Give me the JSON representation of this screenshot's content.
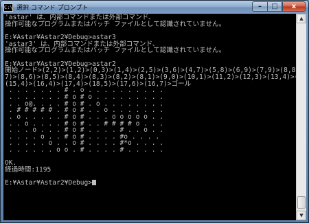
{
  "window": {
    "title": "選択 コマンド プロンプト",
    "app_icon": "cmd-icon",
    "controls": {
      "minimize": "–",
      "maximize": "□",
      "close": "x"
    }
  },
  "console": {
    "text": "'astar' は、内部コマンドまたは外部コマンド、\n操作可能なプログラムまたはバッチ ファイルとして認識されていません。\n\nE:¥Astar¥Astar2¥Debug>astar3\n'astar3' は、内部コマンドまたは外部コマンド、\n操作可能なプログラムまたはバッチ ファイルとして認識されていません。\n\nE:¥Astar¥Astar2¥Debug>astar2\n開始ノード>(2,2)>(1,2)>(0,3)>(1,4)>(2,5)>(3,6)>(4,7)>(5,8)>(6,9)>(7,9)>(8,8)>(8,\n7)>(8,6)>(8,5)>(8,4)>(8,3)>(8,2)>(8,1)>(9,0)>(10,1)>(11,2)>(12,3)>(13,4)>(14,4)>\n(15,4)>(16,4)>(17,4)>(18,5)>(17,6)>(16,7)>ゴール\n . . . . . . . # . o . . . . . . . . . .\n . . . . . . . # o # o . . . . . . . . .\n . . o@. . . . # o # . o . . . . . . . .\n . # # # # # . # o # . . o . . . . . . .\n . o . . . . . # o # . . . o o o o o . .\n . . o . . . . # o # . . # # # # o . . .\n . . . o . . . # o # . . . . # . . o . .\n . . . . o . . # o # . . . . #o . . . .\n . . . . . o . . o # . . . . #*o . . . .\n . . . . . . o o . # . . . . # . . . . .\n\nOK.\n経過時間:1195\n\nE:¥Astar¥Astar2¥Debug>"
  },
  "scrollbar": {
    "up_arrow": "▲",
    "down_arrow": "▼"
  }
}
